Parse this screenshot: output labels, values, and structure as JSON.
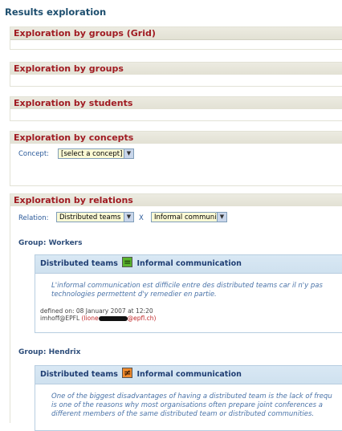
{
  "page": {
    "title": "Results exploration"
  },
  "sections": {
    "grid": {
      "title": "Exploration by groups (Grid)"
    },
    "groups": {
      "title": "Exploration by groups"
    },
    "students": {
      "title": "Exploration by students"
    },
    "concepts": {
      "title": "Exploration by concepts",
      "concept_label": "Concept:",
      "concept_select": "[select a concept]"
    },
    "relations": {
      "title": "Exploration by relations",
      "relation_label": "Relation:",
      "relation_select_1": "Distributed teams",
      "separator": "X",
      "relation_select_2": "Informal communi"
    }
  },
  "groups": [
    {
      "title": "Group: Workers",
      "concept_a": "Distributed teams",
      "relation_symbol": "=",
      "concept_b": "Informal communication",
      "text_lines": [
        "L'informal communication est difficile entre des distributed teams car il n'y pas",
        "technologies permettent d'y remedier en partie."
      ],
      "defined_on": "defined on: 08 January 2007 at 12:20",
      "author": "imhoff@EPFL",
      "email_prefix": "(lione",
      "email_suffix": "@epfl.ch)"
    },
    {
      "title": "Group: Hendrix",
      "concept_a": "Distributed teams",
      "relation_symbol": "≠",
      "concept_b": "Informal communication",
      "text_lines": [
        "One of the biggest disadvantages of having a distributed team is the lack of frequ",
        "is one of the reasons why most organisations often prepare joint conferences a",
        "different members of the same distributed team or distributed communities."
      ]
    }
  ],
  "colors": {
    "section_title": "#a01b22",
    "page_title": "#1d4e6e",
    "select_bg": "#fbf9d4",
    "rel_equal": "#5ab52d",
    "rel_not_equal": "#f08a2c"
  }
}
